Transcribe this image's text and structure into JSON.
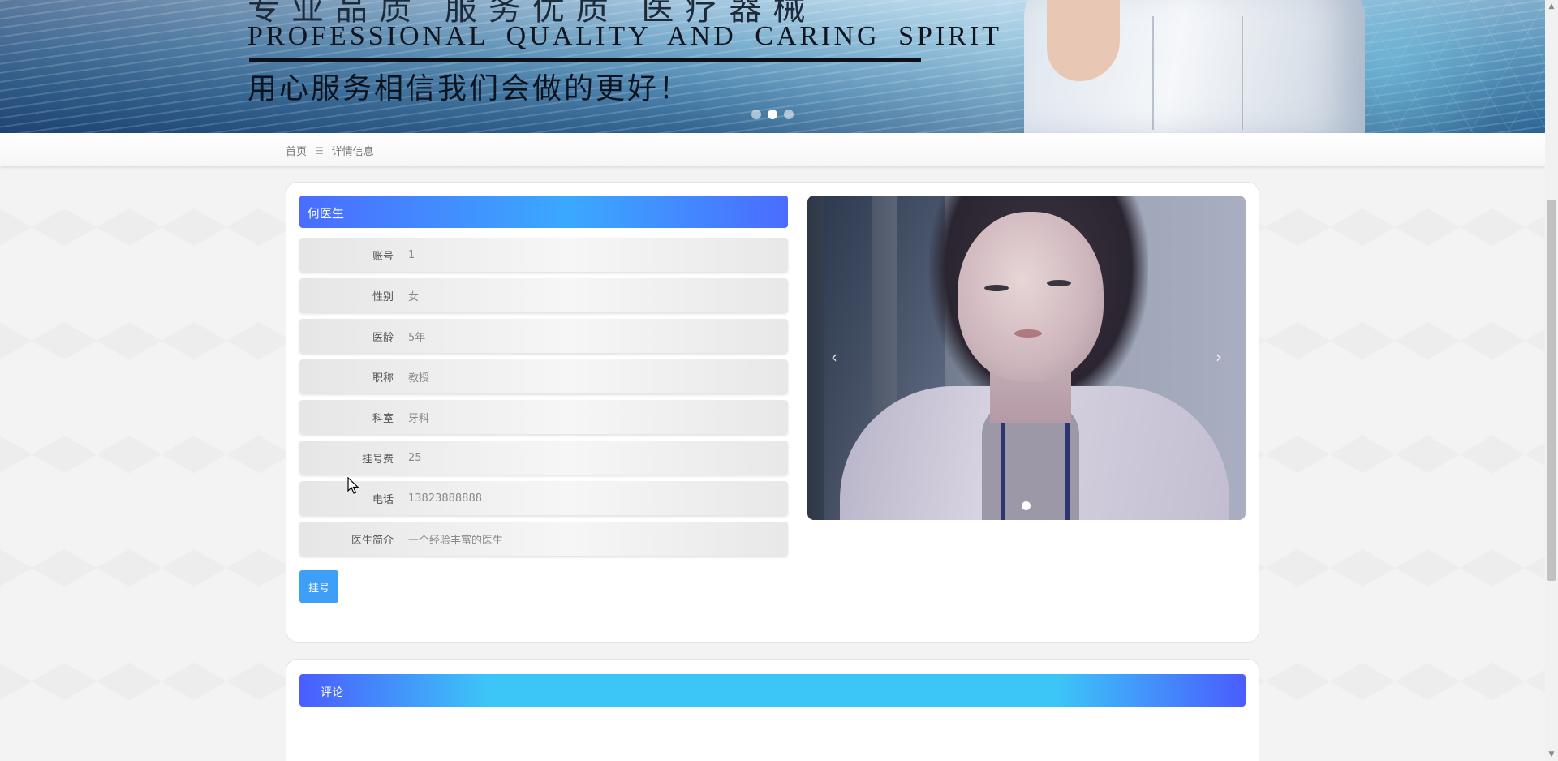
{
  "banner": {
    "heading_cn": "专业品质 服务优质 医疗器械",
    "tagline_en": "PROFESSIONAL QUALITY AND CARING SPIRIT",
    "slogan_cn": "用心服务相信我们会做的更好！",
    "slides": 3,
    "active_slide": 2
  },
  "breadcrumb": {
    "home": "首页",
    "separator": "☰",
    "current": "详情信息"
  },
  "doctor": {
    "name": "何医生",
    "fields": [
      {
        "label": "账号",
        "value": "1"
      },
      {
        "label": "性别",
        "value": "女"
      },
      {
        "label": "医龄",
        "value": "5年"
      },
      {
        "label": "职称",
        "value": "教授"
      },
      {
        "label": "科室",
        "value": "牙科"
      },
      {
        "label": "挂号费",
        "value": "25"
      },
      {
        "label": "电话",
        "value": "13823888888"
      },
      {
        "label": "医生简介",
        "value": "一个经验丰富的医生"
      }
    ],
    "register_button": "挂号"
  },
  "carousel": {
    "prev": "‹",
    "next": "›"
  },
  "comments": {
    "title": "评论"
  },
  "colors": {
    "primary_blue": "#3d9ff5",
    "header_gradient_start": "#4a6cff",
    "header_gradient_mid": "#3ba9ff",
    "comment_gradient_mid": "#3cc6f7"
  }
}
